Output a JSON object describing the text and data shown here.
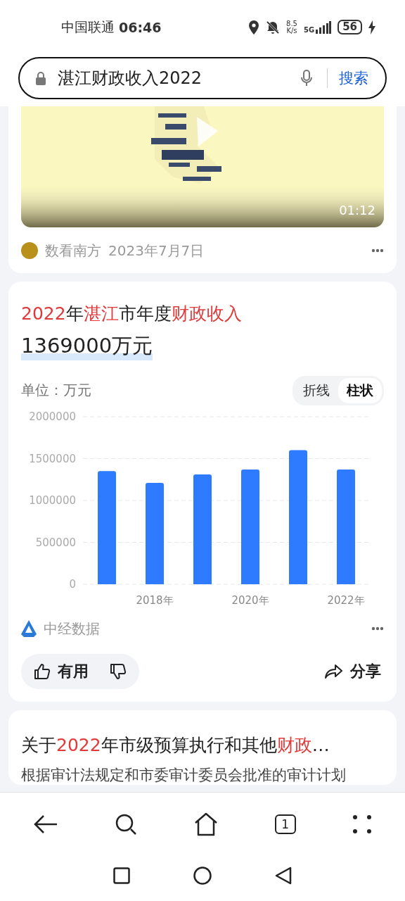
{
  "status_bar": {
    "carrier": "中国联通",
    "time": "06:46",
    "net_speed": "8.5",
    "net_unit": "K/s",
    "network": "5G",
    "battery": "56",
    "charging": true
  },
  "search": {
    "value": "湛江财政收入2022",
    "button": "搜索"
  },
  "cards": [
    {
      "kind": "video",
      "duration": "01:12",
      "source": "数看南方",
      "date": "2023年7月7日"
    },
    {
      "kind": "chart",
      "title": [
        {
          "text": "2022",
          "highlight": true
        },
        {
          "text": "年",
          "highlight": false
        },
        {
          "text": "湛江",
          "highlight": true
        },
        {
          "text": "市年度",
          "highlight": false
        },
        {
          "text": "财政收入",
          "highlight": true
        }
      ],
      "value": "1369000万元",
      "unit": "单位：万元",
      "toggle": [
        {
          "label": "折线",
          "selected": false
        },
        {
          "label": "柱状",
          "selected": true
        }
      ],
      "chart_data": {
        "type": "bar",
        "categories": [
          null,
          "2018年",
          null,
          "2020年",
          null,
          "2022年"
        ],
        "series": [
          {
            "color": "#2f7bff",
            "values": [
              1350000,
              1210000,
              1310000,
              1370000,
              1600000,
              1370000
            ]
          }
        ],
        "ylim": [
          0,
          2000000
        ],
        "grid": true,
        "yticks": [
          0,
          500000,
          1000000,
          1500000,
          2000000
        ]
      },
      "source": "中经数据",
      "useful": "有用",
      "share": "分享"
    },
    {
      "kind": "article",
      "title": [
        {
          "text": "关于",
          "highlight": false
        },
        {
          "text": "2022",
          "highlight": true
        },
        {
          "text": "年市级预算执行和其他",
          "highlight": false
        },
        {
          "text": "财政",
          "highlight": true
        },
        {
          "text": "…",
          "highlight": false
        }
      ],
      "snippet": "根据审计法规定和市委审计委员会批准的审计计划"
    }
  ],
  "bottom_nav": {
    "tab_count": "1"
  }
}
